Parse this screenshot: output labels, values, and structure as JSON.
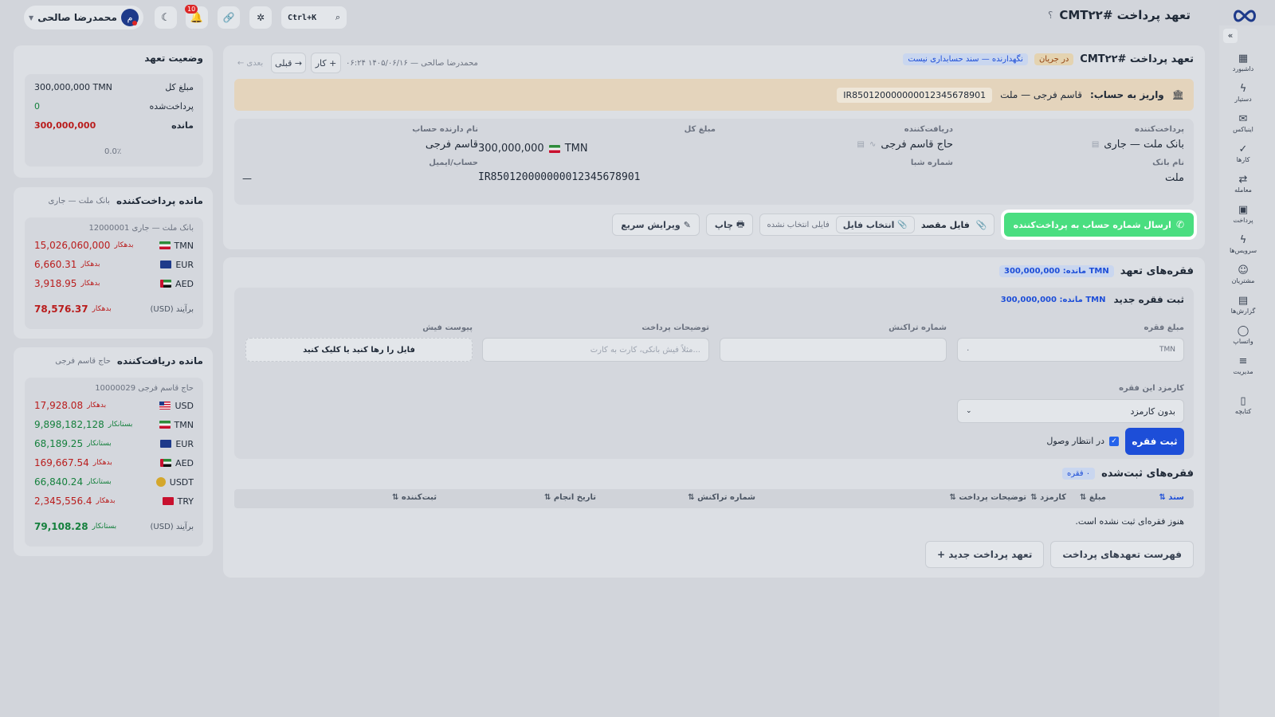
{
  "header": {
    "title": "تعهد پرداخت #CMT۲۲",
    "help": "؟",
    "user_name": "محمدرضا صالحی",
    "avatar_letter": "م",
    "search_shortcut": "Ctrl+K",
    "notif_count": "10"
  },
  "sidebar": {
    "items": [
      {
        "label": "داشبورد",
        "icon": "grid-icon"
      },
      {
        "label": "دستیار",
        "icon": "bolt-icon"
      },
      {
        "label": "اینباکس",
        "icon": "inbox-icon"
      },
      {
        "label": "کارها",
        "icon": "check-icon"
      },
      {
        "label": "معامله",
        "icon": "swap-icon"
      },
      {
        "label": "پرداخت",
        "icon": "wallet-icon"
      },
      {
        "label": "سرویس‌ها",
        "icon": "bolt-icon"
      },
      {
        "label": "مشتریان",
        "icon": "users-icon"
      },
      {
        "label": "گزارش‌ها",
        "icon": "report-icon"
      },
      {
        "label": "واتساپ",
        "icon": "chat-icon"
      },
      {
        "label": "مدیریت",
        "icon": "sliders-icon"
      },
      {
        "label": "کتابچه",
        "icon": "book-icon"
      }
    ]
  },
  "commitment": {
    "title": "تعهد پرداخت #CMT۲۲",
    "status": "در جریان",
    "accounting_tag": "نگهدارنده — سند حسابداری نیست",
    "meta": "محمدرضا صالحی — ۱۴۰۵/۰۶/۱۶ ۰۶:۲۴",
    "add_task": "+ کار",
    "prev": "→ قبلی",
    "next": "بعدی ←",
    "deposit_label": "واریز به حساب:",
    "deposit_name": "قاسم فرجی — ملت",
    "deposit_iban": "IR850120000000012345678901",
    "payer_label": "پرداخت‌کننده",
    "payer_value": "بانک ملت — جاری",
    "receiver_label": "دریافت‌کننده",
    "receiver_value": "حاج قاسم فرجی",
    "total_label": "مبلغ کل",
    "total_value": "300,000,000",
    "total_currency": "TMN",
    "holder_label": "نام دارنده حساب",
    "holder_value": "قاسم فرجی",
    "bank_label": "نام بانک",
    "bank_value": "ملت",
    "sheba_label": "شماره شبا",
    "sheba_value": "IR850120000000012345678901",
    "account_label": "حساب/ایمیل",
    "account_value": "—",
    "btn_send": "ارسال شماره حساب به پرداخت‌کننده",
    "btn_target_file": "فایل مقصد",
    "btn_choose_file": "انتخاب فایل",
    "no_file": "فایلی انتخاب نشده",
    "btn_print": "چاپ",
    "btn_quick_edit": "ویرایش سریع"
  },
  "installments": {
    "title": "فقره‌های تعهد",
    "remain_badge": "TMN مانده: 300,000,000",
    "new_title": "ثبت فقره جدید",
    "new_remain": "TMN مانده: 300,000,000",
    "amount_label": "مبلغ فقره",
    "amount_placeholder": "TMN",
    "amount_value": "۰",
    "txn_label": "شماره تراکنش",
    "desc_label": "توضیحات پرداخت",
    "desc_placeholder": "مثلاً فیش بانکی، کارت به کارت...",
    "receipt_label": "پیوست فیش",
    "drop_text": "فایل را رها کنید یا کلیک کنید",
    "fee_label": "کارمزد این فقره",
    "fee_value": "بدون کارمزد",
    "submit": "ثبت فقره",
    "pending_label": "در انتظار وصول",
    "registered_title": "فقره‌های ثبت‌شده",
    "registered_count": "۰ فقره",
    "columns": [
      "سند ⇅",
      "مبلغ ⇅",
      "کارمزد ⇅",
      "توضیحات پرداخت ⇅",
      "شماره تراکنش ⇅",
      "تاریخ انجام ⇅",
      "ثبت‌کننده ⇅"
    ],
    "empty": "هنوز فقره‌ای ثبت نشده است.",
    "btn_list": "فهرست تعهدهای پرداخت",
    "btn_new": "+ تعهد پرداخت جدید"
  },
  "status_panel": {
    "title": "وضعیت تعهد",
    "rows": [
      {
        "label": "مبلغ کل",
        "value": "300,000,000 TMN"
      },
      {
        "label": "پرداخت‌شده",
        "value": "0"
      },
      {
        "label": "مانده",
        "value": "300,000,000"
      }
    ],
    "progress": "0.0٪"
  },
  "payer_balance": {
    "title": "مانده پرداخت‌کننده",
    "subtitle": "بانک ملت — جاری",
    "account": "بانک ملت — جاری 12000001",
    "rows": [
      {
        "cur": "TMN",
        "flag": "ir",
        "amount": "15,026,060,000",
        "side": "بدهکار",
        "tone": "red"
      },
      {
        "cur": "EUR",
        "flag": "eu",
        "amount": "6,660.31",
        "side": "بدهکار",
        "tone": "red"
      },
      {
        "cur": "AED",
        "flag": "ae",
        "amount": "3,918.95",
        "side": "بدهکار",
        "tone": "red"
      }
    ],
    "total_label": "برآیند (USD)",
    "total_amount": "78,576.37",
    "total_side": "بدهکار"
  },
  "receiver_balance": {
    "title": "مانده دریافت‌کننده",
    "subtitle": "حاج قاسم فرجی",
    "account": "حاج قاسم فرجی 10000029",
    "rows": [
      {
        "cur": "USD",
        "flag": "us",
        "amount": "17,928.08",
        "side": "بدهکار",
        "tone": "red"
      },
      {
        "cur": "TMN",
        "flag": "ir",
        "amount": "9,898,182,128",
        "side": "بستانکار",
        "tone": "green"
      },
      {
        "cur": "EUR",
        "flag": "eu",
        "amount": "68,189.25",
        "side": "بستانکار",
        "tone": "green"
      },
      {
        "cur": "AED",
        "flag": "ae",
        "amount": "169,667.54",
        "side": "بدهکار",
        "tone": "red"
      },
      {
        "cur": "USDT",
        "flag": "coin",
        "amount": "66,840.24",
        "side": "بستانکار",
        "tone": "green"
      },
      {
        "cur": "TRY",
        "flag": "tr",
        "amount": "2,345,556.4",
        "side": "بدهکار",
        "tone": "red"
      }
    ],
    "total_label": "برآیند (USD)",
    "total_amount": "79,108.28",
    "total_side": "بستانکار"
  },
  "colors": {
    "accent": "#1d4ed8",
    "whatsapp": "#4ade80",
    "red": "#b91c1c",
    "green": "#15803d",
    "banner": "#e9d9bf"
  }
}
